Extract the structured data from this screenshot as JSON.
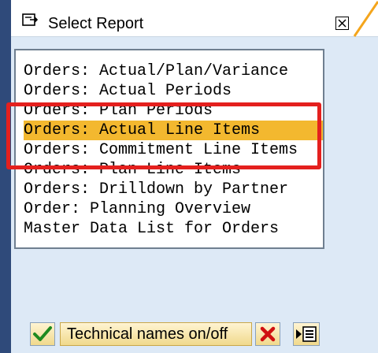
{
  "dialog": {
    "title": "Select Report",
    "close_glyph": "☒"
  },
  "reports": [
    {
      "label": "Orders: Actual/Plan/Variance",
      "selected": false
    },
    {
      "label": "Orders: Actual Periods",
      "selected": false
    },
    {
      "label": "Orders: Plan Periods",
      "selected": false
    },
    {
      "label": "Orders: Actual Line Items",
      "selected": true
    },
    {
      "label": "Orders: Commitment Line Items",
      "selected": false
    },
    {
      "label": "Orders: Plan Line Items",
      "selected": false
    },
    {
      "label": "Orders: Drilldown by Partner",
      "selected": false
    },
    {
      "label": "Order: Planning Overview",
      "selected": false
    },
    {
      "label": "Master Data List for Orders",
      "selected": false
    }
  ],
  "toolbar": {
    "ok_icon": "check-icon",
    "technical_names_label": "Technical names on/off",
    "cancel_icon": "cancel-x-icon",
    "expand_icon": "expand-list-icon"
  },
  "colors": {
    "selection": "#f3b82f",
    "highlight_border": "#e4201e",
    "dialog_background": "#dde9f6",
    "left_stripe": "#2f4a7a"
  }
}
